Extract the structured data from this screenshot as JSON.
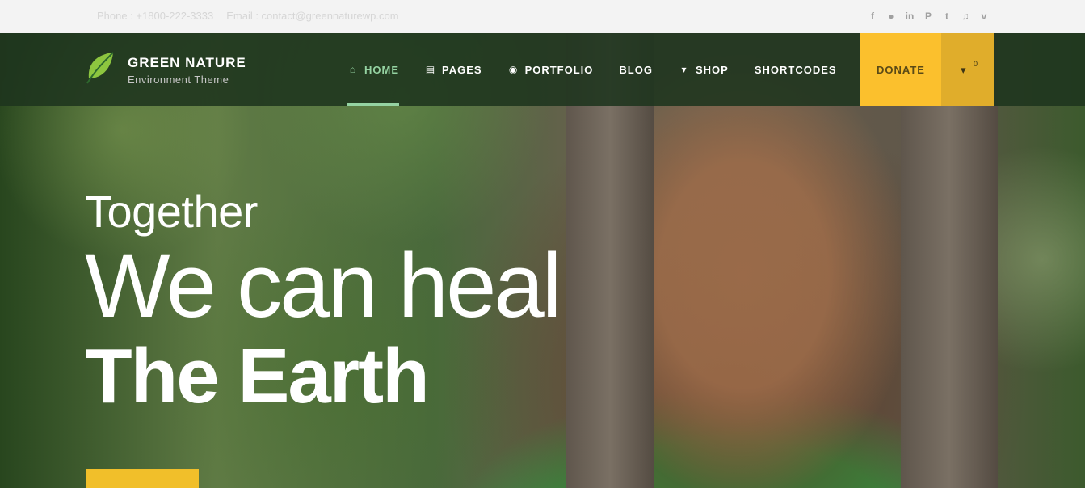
{
  "topbar": {
    "phone": "Phone : +1800-222-3333",
    "email": "Email : contact@greennaturewp.com",
    "social": [
      {
        "icon": "facebook-icon",
        "glyph": "f"
      },
      {
        "icon": "flickr-icon",
        "glyph": "●"
      },
      {
        "icon": "linkedin-icon",
        "glyph": "in"
      },
      {
        "icon": "pinterest-icon",
        "glyph": "P"
      },
      {
        "icon": "tumblr-icon",
        "glyph": "t"
      },
      {
        "icon": "twitter-icon",
        "glyph": "🐦"
      },
      {
        "icon": "vimeo-icon",
        "glyph": "v"
      }
    ]
  },
  "header": {
    "brand_name": "GREEN NATURE",
    "brand_tagline": "Environment Theme",
    "nav": [
      {
        "label": "HOME",
        "icon": "home-icon",
        "glyph": "⌂",
        "active": true
      },
      {
        "label": "PAGES",
        "icon": "document-icon",
        "glyph": "▤",
        "active": false
      },
      {
        "label": "PORTFOLIO",
        "icon": "globe-icon",
        "glyph": "◉",
        "active": false
      },
      {
        "label": "BLOG",
        "icon": "",
        "glyph": "",
        "active": false
      },
      {
        "label": "SHOP",
        "icon": "cart-icon",
        "glyph": "🛒",
        "active": false
      },
      {
        "label": "SHORTCODES",
        "icon": "",
        "glyph": "",
        "active": false
      }
    ],
    "donate_label": "DONATE",
    "cart_count": "0"
  },
  "hero": {
    "line1": "Together",
    "line2": "We can heal",
    "line3": "The Earth"
  },
  "colors": {
    "accent_yellow": "#fbc02d",
    "nav_active": "#95d3a2",
    "header_bg": "#1e341e"
  }
}
